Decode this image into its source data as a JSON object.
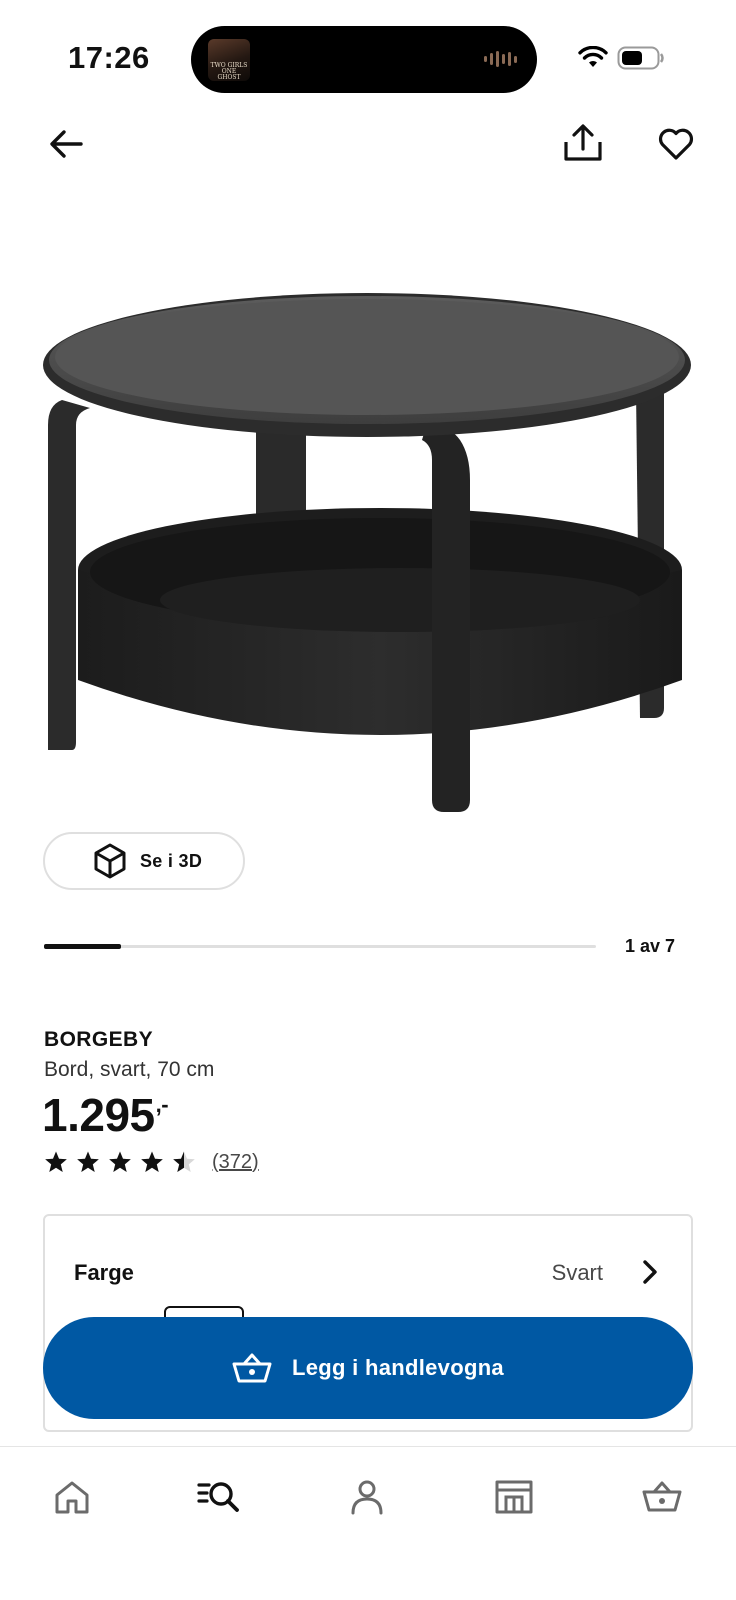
{
  "status_bar": {
    "time": "17:26",
    "now_playing_art_text": "TWO GIRLS ONE GHOST"
  },
  "nav": {
    "back_icon": "arrow-left-icon",
    "share_icon": "share-icon",
    "favorite_icon": "heart-icon"
  },
  "product_image": {
    "description_icon": "coffee-table-image"
  },
  "view_3d": {
    "label": "Se i 3D",
    "icon": "cube-icon"
  },
  "gallery": {
    "current": 1,
    "total": 7,
    "label": "1 av 7",
    "progress_fraction": 0.14
  },
  "product": {
    "name": "BORGEBY",
    "description": "Bord, svart, 70 cm",
    "price": "1.295",
    "price_suffix": ",-",
    "rating": 4.5,
    "rating_max": 5,
    "review_count": "(372)"
  },
  "color_option": {
    "title": "Farge",
    "value": "Svart"
  },
  "cart_button": {
    "label": "Legg i handlevogna",
    "icon": "basket-icon"
  },
  "tabbar": {
    "items": [
      {
        "name": "home",
        "icon": "home-icon"
      },
      {
        "name": "search",
        "icon": "search-icon",
        "active": true
      },
      {
        "name": "profile",
        "icon": "person-icon"
      },
      {
        "name": "store",
        "icon": "store-icon"
      },
      {
        "name": "cart",
        "icon": "basket-icon"
      }
    ]
  },
  "colors": {
    "primary_blue": "#0058a3",
    "text_dark": "#111111",
    "text_muted": "#484848",
    "border": "#dfdfdf"
  }
}
